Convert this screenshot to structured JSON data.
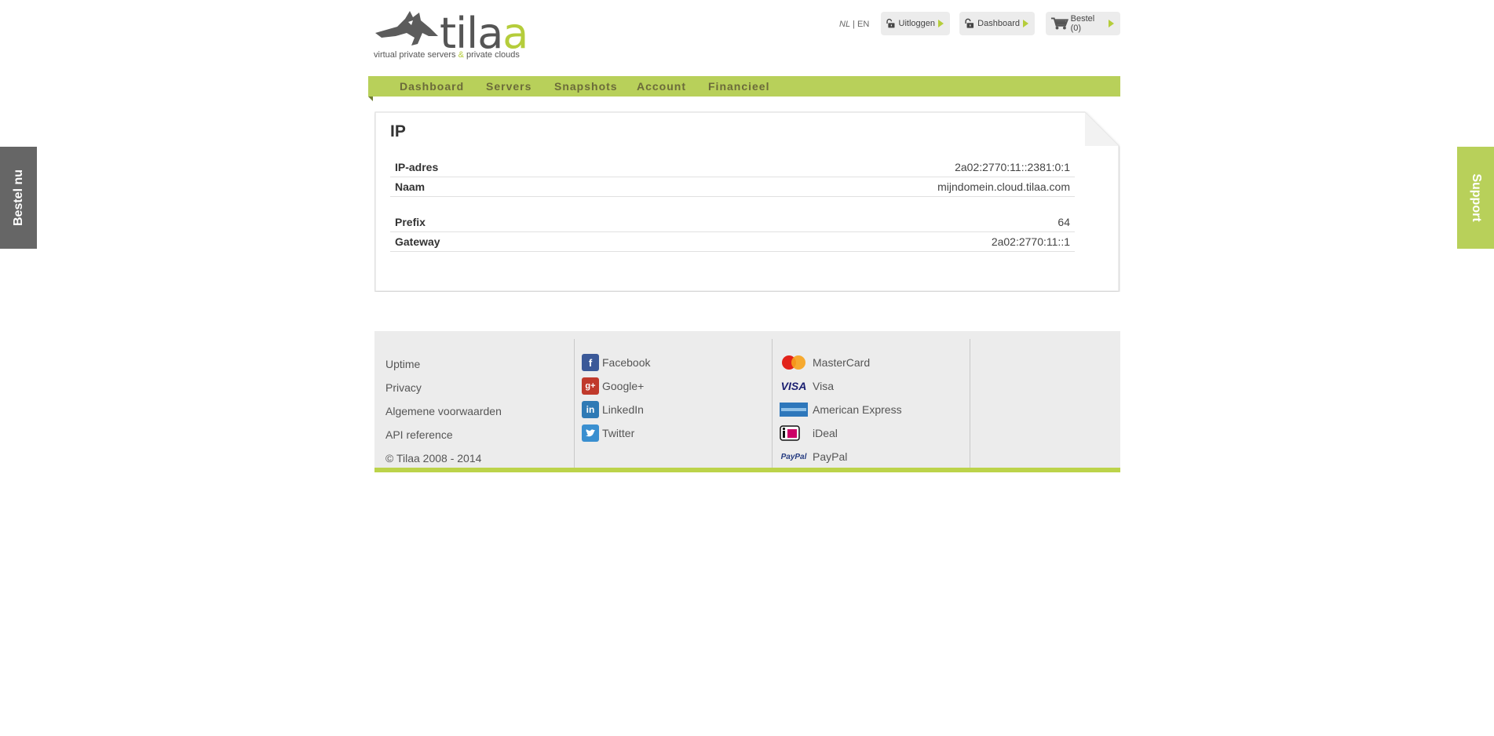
{
  "header": {
    "brand": {
      "wordmark_start": "til",
      "wordmark_a1": "a",
      "wordmark_a2": "a",
      "tagline_start": "virtual private servers ",
      "tagline_amp": "&",
      "tagline_end": " private clouds"
    },
    "lang": {
      "nl": "NL",
      "sep": " | ",
      "en": "EN"
    },
    "buttons": {
      "logout": "Uitloggen",
      "dashboard": "Dashboard",
      "order": "Bestel (0)"
    }
  },
  "nav": {
    "items": [
      "Dashboard",
      "Servers",
      "Snapshots",
      "Account",
      "Financieel"
    ]
  },
  "panel": {
    "title": "IP",
    "rows": [
      {
        "label": "IP-adres",
        "value": "2a02:2770:11::2381:0:1"
      },
      {
        "label": "Naam",
        "value": "mijndomein.cloud.tilaa.com"
      },
      {
        "label": "Prefix",
        "value": "64"
      },
      {
        "label": "Gateway",
        "value": "2a02:2770:11::1"
      }
    ]
  },
  "footer": {
    "links": [
      "Uptime",
      "Privacy",
      "Algemene voorwaarden",
      "API reference"
    ],
    "copyright": "© Tilaa 2008 - 2014",
    "social": [
      {
        "label": "Facebook",
        "icon": "facebook-icon"
      },
      {
        "label": "Google+",
        "icon": "google-plus-icon"
      },
      {
        "label": "LinkedIn",
        "icon": "linkedin-icon"
      },
      {
        "label": "Twitter",
        "icon": "twitter-icon"
      }
    ],
    "payments": [
      {
        "label": "MasterCard",
        "icon": "mastercard-icon"
      },
      {
        "label": "Visa",
        "icon": "visa-icon"
      },
      {
        "label": "American Express",
        "icon": "amex-icon"
      },
      {
        "label": "iDeal",
        "icon": "ideal-icon"
      },
      {
        "label": "PayPal",
        "icon": "paypal-icon"
      }
    ]
  },
  "side_tabs": {
    "left": "Bestel nu",
    "right": "Support"
  },
  "colors": {
    "accent": "#b8d05a",
    "footer_bar": "#bcd34a",
    "left_tab": "#666666"
  }
}
